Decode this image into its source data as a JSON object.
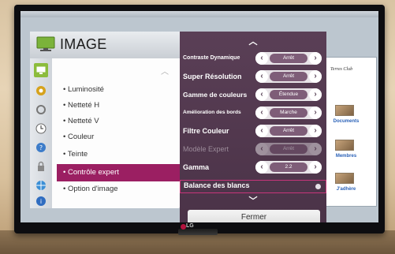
{
  "menu": {
    "title": "IMAGE",
    "items": [
      {
        "label": "Luminosité"
      },
      {
        "label": "Netteté H"
      },
      {
        "label": "Netteté V"
      },
      {
        "label": "Couleur"
      },
      {
        "label": "Teinte"
      },
      {
        "label": "Contrôle expert",
        "selected": true
      },
      {
        "label": "Option d'image"
      }
    ],
    "icons": [
      "picture-icon",
      "audio-icon",
      "clock-icon",
      "option-icon",
      "network-icon",
      "support-icon"
    ]
  },
  "expert": {
    "rows": [
      {
        "label": "Contraste Dynamique",
        "value": "Arrêt"
      },
      {
        "label": "Super Résolution",
        "value": "Arrêt"
      },
      {
        "label": "Gamme de couleurs",
        "value": "Étendue"
      },
      {
        "label": "Amélioration des bords",
        "value": "Marche"
      },
      {
        "label": "Filtre Couleur",
        "value": "Arrêt"
      },
      {
        "label": "Modèle Expert",
        "value": "Arrêt",
        "disabled": true
      },
      {
        "label": "Gamma",
        "value": "2.2"
      }
    ],
    "balance_label": "Balance des blancs",
    "close_label": "Fermer"
  },
  "background_site": {
    "logo": "Terres Club",
    "links": [
      "Documents",
      "Membres",
      "J'adhère"
    ]
  },
  "tv": {
    "brand": "LG"
  },
  "colors": {
    "panel_purple": "#4f3650",
    "selection_magenta": "#9b1f62",
    "accent_green": "#8cbc3c"
  }
}
